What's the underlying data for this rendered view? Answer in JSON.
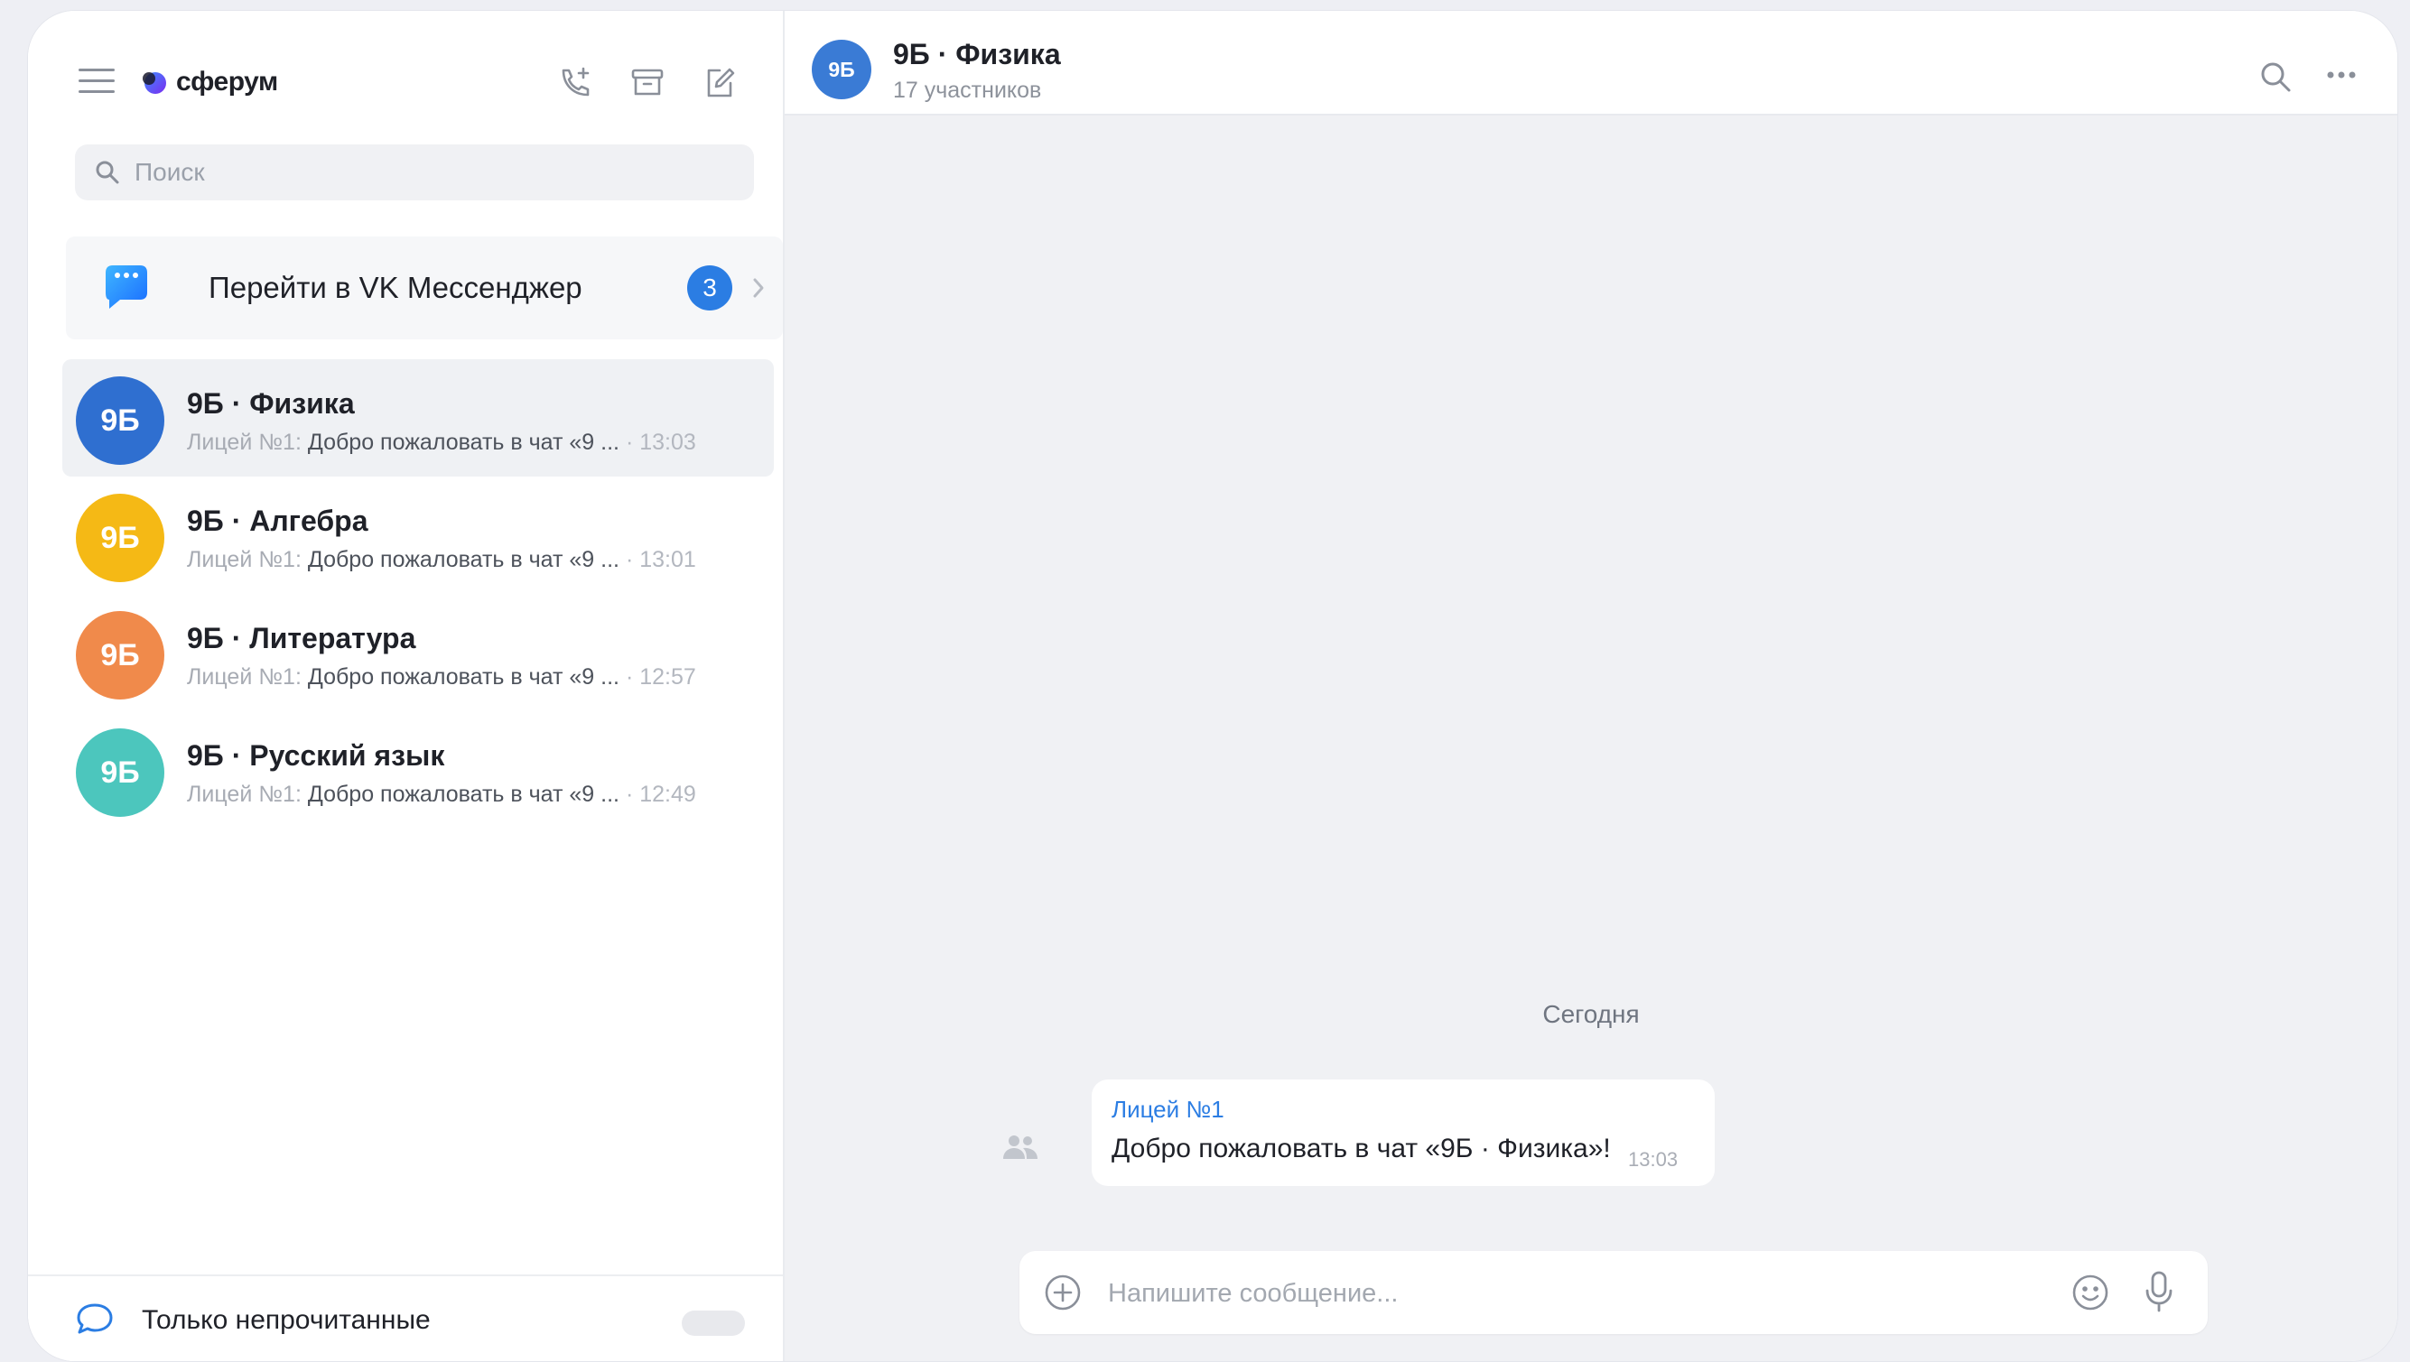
{
  "app": {
    "logo_text": "сферум"
  },
  "sidebar": {
    "search_placeholder": "Поиск",
    "vk_banner": {
      "label": "Перейти в VK Мессенджер",
      "badge": "3"
    },
    "chats": [
      {
        "avatar_text": "9Б",
        "avatar_color": "#2f6fd0",
        "title": "9Б · Физика",
        "sender": "Лицей №1:",
        "preview": "Добро пожаловать в чат «9 ...",
        "time": "· 13:03",
        "active": true
      },
      {
        "avatar_text": "9Б",
        "avatar_color": "#f5b915",
        "title": "9Б · Алгебра",
        "sender": "Лицей №1:",
        "preview": "Добро пожаловать в чат «9 ...",
        "time": "· 13:01",
        "active": false
      },
      {
        "avatar_text": "9Б",
        "avatar_color": "#f08a4b",
        "title": "9Б · Литература",
        "sender": "Лицей №1:",
        "preview": "Добро пожаловать в чат «9 ...",
        "time": "· 12:57",
        "active": false
      },
      {
        "avatar_text": "9Б",
        "avatar_color": "#4cc6bd",
        "title": "9Б · Русский язык",
        "sender": "Лицей №1:",
        "preview": "Добро пожаловать в чат «9 ...",
        "time": "· 12:49",
        "active": false
      }
    ],
    "footer": {
      "unread_label": "Только непрочитанные",
      "toggle_on": false
    }
  },
  "chat": {
    "header": {
      "avatar_text": "9Б",
      "title": "9Б · Физика",
      "subtitle": "17 участников"
    },
    "date_separator": "Сегодня",
    "message": {
      "sender": "Лицей №1",
      "text": "Добро пожаловать в чат «9Б · Физика»!",
      "time": "13:03"
    },
    "composer_placeholder": "Напишите сообщение..."
  },
  "colors": {
    "accent": "#2b7de3",
    "pane_bg": "#f0f1f4"
  }
}
